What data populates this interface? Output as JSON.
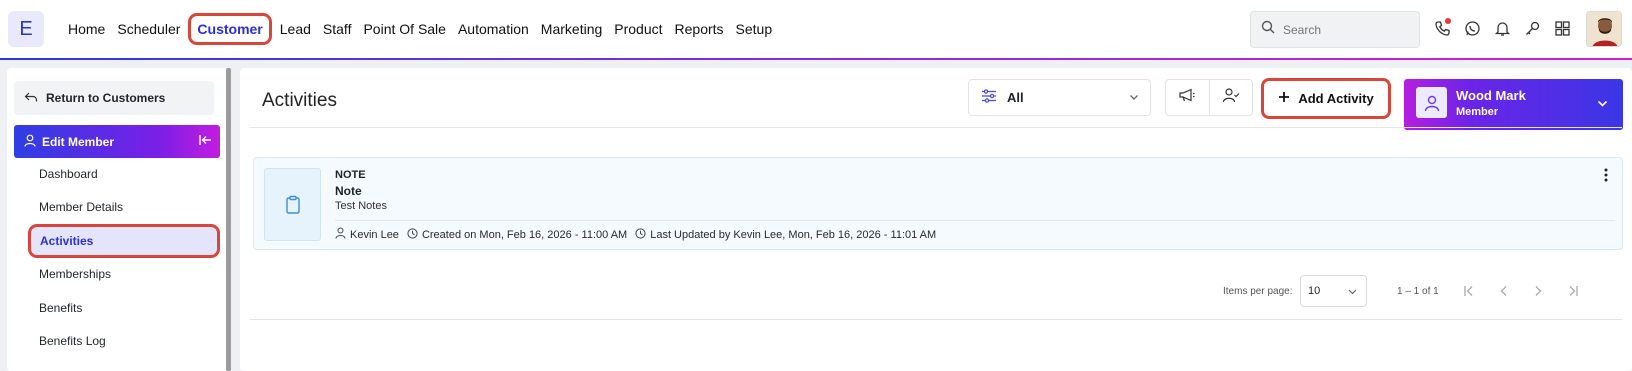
{
  "app": {
    "logo_letter": "E"
  },
  "nav": {
    "items": [
      {
        "label": "Home"
      },
      {
        "label": "Scheduler"
      },
      {
        "label": "Customer",
        "active": true
      },
      {
        "label": "Lead"
      },
      {
        "label": "Staff"
      },
      {
        "label": "Point Of Sale"
      },
      {
        "label": "Automation"
      },
      {
        "label": "Marketing"
      },
      {
        "label": "Product"
      },
      {
        "label": "Reports"
      },
      {
        "label": "Setup"
      }
    ]
  },
  "search": {
    "placeholder": "Search"
  },
  "top_icons": [
    "phone-icon",
    "whatsapp-icon",
    "bell-icon",
    "key-icon",
    "grid-icon"
  ],
  "sidebar": {
    "return_label": "Return to Customers",
    "section_label": "Edit Member",
    "items": [
      {
        "label": "Dashboard"
      },
      {
        "label": "Member Details"
      },
      {
        "label": "Activities",
        "active": true
      },
      {
        "label": "Memberships"
      },
      {
        "label": "Benefits"
      },
      {
        "label": "Benefits Log"
      }
    ]
  },
  "main": {
    "title": "Activities",
    "filter_value": "All",
    "add_button": "Add Activity",
    "member": {
      "name": "Wood Mark",
      "role": "Member"
    }
  },
  "activity": {
    "type": "NOTE",
    "title": "Note",
    "body": "Test Notes",
    "author": "Kevin Lee",
    "created": "Created on Mon, Feb 16, 2026 - 11:00 AM",
    "updated": "Last Updated by Kevin Lee, Mon, Feb 16, 2026 - 11:01 AM"
  },
  "pagination": {
    "items_per_page_label": "Items per page:",
    "items_per_page": "10",
    "range": "1 – 1 of 1"
  },
  "colors": {
    "accent": "#2b2ee0",
    "highlight": "#d9453a"
  }
}
